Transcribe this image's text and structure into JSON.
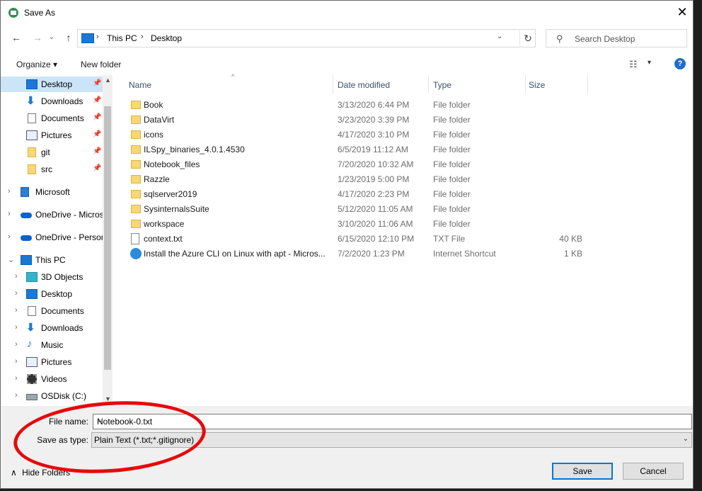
{
  "window": {
    "title": "Save As",
    "close_symbol": "✕"
  },
  "nav": {
    "back_symbol": "←",
    "forward_symbol": "→",
    "dropdown_symbol": "⌄",
    "up_symbol": "↑",
    "breadcrumbs": [
      "This PC",
      "Desktop"
    ],
    "crumb_sep": "›",
    "refresh_symbol": "↻",
    "search_placeholder": "Search Desktop"
  },
  "toolbar": {
    "organize_label": "Organize ▾",
    "new_folder_label": "New folder",
    "help_symbol": "?",
    "view_symbol": "☷",
    "view_dd": "▾"
  },
  "sidebar": {
    "pin_symbol": "📌",
    "quick_access": [
      {
        "label": "Desktop",
        "icon": "desktop-icon"
      },
      {
        "label": "Downloads",
        "icon": "download-icon"
      },
      {
        "label": "Documents",
        "icon": "documents-icon"
      },
      {
        "label": "Pictures",
        "icon": "pictures-icon"
      },
      {
        "label": "git",
        "icon": "folder-icon"
      },
      {
        "label": "src",
        "icon": "folder-icon"
      }
    ],
    "roots": [
      {
        "label": "Microsoft",
        "icon": "microsoft-icon"
      },
      {
        "label": "OneDrive - Micros",
        "icon": "onedrive-icon"
      },
      {
        "label": "OneDrive - Person",
        "icon": "onedrive-icon"
      },
      {
        "label": "This PC",
        "icon": "pc-icon"
      }
    ],
    "this_pc_children": [
      {
        "label": "3D Objects",
        "icon": "3d-objects-icon"
      },
      {
        "label": "Desktop",
        "icon": "desktop-icon"
      },
      {
        "label": "Documents",
        "icon": "documents-icon"
      },
      {
        "label": "Downloads",
        "icon": "download-icon"
      },
      {
        "label": "Music",
        "icon": "music-icon"
      },
      {
        "label": "Pictures",
        "icon": "pictures-icon"
      },
      {
        "label": "Videos",
        "icon": "videos-icon"
      },
      {
        "label": "OSDisk (C:)",
        "icon": "disk-icon"
      }
    ]
  },
  "columns": {
    "name": "Name",
    "date": "Date modified",
    "type": "Type",
    "size": "Size"
  },
  "files": [
    {
      "name": "Book",
      "date": "3/13/2020 6:44 PM",
      "type": "File folder",
      "size": "",
      "kind": "folder"
    },
    {
      "name": "DataVirt",
      "date": "3/23/2020 3:39 PM",
      "type": "File folder",
      "size": "",
      "kind": "folder"
    },
    {
      "name": "icons",
      "date": "4/17/2020 3:10 PM",
      "type": "File folder",
      "size": "",
      "kind": "folder"
    },
    {
      "name": "ILSpy_binaries_4.0.1.4530",
      "date": "6/5/2019 11:12 AM",
      "type": "File folder",
      "size": "",
      "kind": "folder"
    },
    {
      "name": "Notebook_files",
      "date": "7/20/2020 10:32 AM",
      "type": "File folder",
      "size": "",
      "kind": "folder"
    },
    {
      "name": "Razzle",
      "date": "1/23/2019 5:00 PM",
      "type": "File folder",
      "size": "",
      "kind": "folder"
    },
    {
      "name": "sqlserver2019",
      "date": "4/17/2020 2:23 PM",
      "type": "File folder",
      "size": "",
      "kind": "folder"
    },
    {
      "name": "SysinternalsSuite",
      "date": "5/12/2020 11:05 AM",
      "type": "File folder",
      "size": "",
      "kind": "folder"
    },
    {
      "name": "workspace",
      "date": "3/10/2020 11:06 AM",
      "type": "File folder",
      "size": "",
      "kind": "folder"
    },
    {
      "name": "context.txt",
      "date": "6/15/2020 12:10 PM",
      "type": "TXT File",
      "size": "40 KB",
      "kind": "txt"
    },
    {
      "name": "Install the Azure CLI on Linux with apt - Micros...",
      "date": "7/2/2020 1:23 PM",
      "type": "Internet Shortcut",
      "size": "1 KB",
      "kind": "url"
    }
  ],
  "form": {
    "file_name_label": "File name:",
    "file_name_value": "Notebook-0.txt",
    "save_type_label": "Save as type:",
    "save_type_value": "Plain Text (*.txt;*.gitignore)",
    "chevron_symbol": "⌄",
    "hide_folders_label": "Hide Folders",
    "hide_symbol": "∧",
    "save_label": "Save",
    "cancel_label": "Cancel"
  },
  "colors": {
    "selection": "#cce4f7",
    "accent": "#0078d7",
    "annotation": "#e50b0b"
  }
}
